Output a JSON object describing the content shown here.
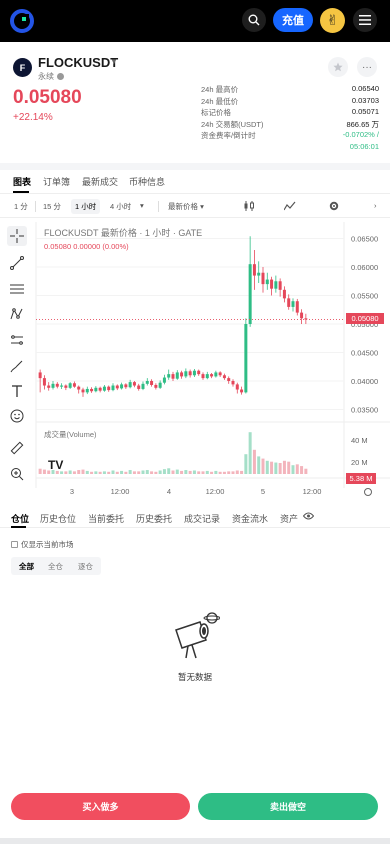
{
  "header": {
    "deposit_label": "充值",
    "avatar_glyph": "✌"
  },
  "pair": {
    "name": "FLOCKUSDT",
    "icon_letter": "F",
    "type_label": "永续",
    "last_price": "0.05080",
    "change_pct": "+22.14%"
  },
  "stats": [
    {
      "label": "24h 最高价",
      "value": "0.06540"
    },
    {
      "label": "24h 最低价",
      "value": "0.03703"
    },
    {
      "label": "标记价格",
      "value": "0.05071"
    },
    {
      "label": "24h 交易额(USDT)",
      "value": "866.65 万"
    },
    {
      "label": "资金费率/倒计时",
      "value": "-0.0702% /"
    },
    {
      "label": "",
      "value": "05:06:01"
    }
  ],
  "tabs": [
    "图表",
    "订单簿",
    "最新成交",
    "币种信息"
  ],
  "toolbar": {
    "intervals": [
      "1 分",
      "15 分",
      "1 小时",
      "4 小时"
    ],
    "active_interval": "1 小时",
    "price_type": "最新价格"
  },
  "chart": {
    "legend_title": "FLOCKUSDT 最新价格 · 1 小时 · GATE",
    "legend_values": "0.05080  0.00000 (0.00%)",
    "volume_label": "成交量(Volume)",
    "price_tag": "0.05080",
    "volume_tag": "5.38 M",
    "tv_logo": "TV"
  },
  "chart_data": {
    "type": "candlestick",
    "title": "FLOCKUSDT 最新价格 · 1 小时 · GATE",
    "price_ticks": [
      "0.06500",
      "0.06000",
      "0.05500",
      "0.05000",
      "0.04500",
      "0.04000",
      "0.03500"
    ],
    "volume_ticks": [
      "40 M",
      "20 M"
    ],
    "x_ticks": [
      "3",
      "12:00",
      "4",
      "12:00",
      "5",
      "12:00"
    ],
    "ylim": [
      0.0335,
      0.0665
    ],
    "volume_max": 50,
    "candles": [
      [
        0.0415,
        0.0405,
        0.042,
        0.038,
        0.12,
        "d"
      ],
      [
        0.0405,
        0.0392,
        0.041,
        0.0385,
        0.1,
        "d"
      ],
      [
        0.0392,
        0.0388,
        0.0398,
        0.0383,
        0.08,
        "d"
      ],
      [
        0.0388,
        0.0395,
        0.04,
        0.0385,
        0.09,
        "u"
      ],
      [
        0.0395,
        0.039,
        0.0398,
        0.0387,
        0.07,
        "d"
      ],
      [
        0.039,
        0.0392,
        0.0396,
        0.0386,
        0.06,
        "u"
      ],
      [
        0.0392,
        0.0388,
        0.0394,
        0.0384,
        0.06,
        "d"
      ],
      [
        0.0388,
        0.0396,
        0.0398,
        0.0386,
        0.08,
        "u"
      ],
      [
        0.0396,
        0.039,
        0.0399,
        0.0388,
        0.06,
        "d"
      ],
      [
        0.039,
        0.0385,
        0.0392,
        0.0378,
        0.09,
        "d"
      ],
      [
        0.0385,
        0.038,
        0.0388,
        0.0372,
        0.1,
        "d"
      ],
      [
        0.038,
        0.0386,
        0.039,
        0.0377,
        0.07,
        "u"
      ],
      [
        0.0386,
        0.0382,
        0.0389,
        0.0379,
        0.05,
        "d"
      ],
      [
        0.0382,
        0.0388,
        0.0391,
        0.038,
        0.06,
        "u"
      ],
      [
        0.0388,
        0.0383,
        0.039,
        0.038,
        0.05,
        "d"
      ],
      [
        0.0383,
        0.039,
        0.0393,
        0.0381,
        0.06,
        "u"
      ],
      [
        0.039,
        0.0384,
        0.0392,
        0.0381,
        0.05,
        "d"
      ],
      [
        0.0384,
        0.0392,
        0.0396,
        0.0382,
        0.08,
        "u"
      ],
      [
        0.0392,
        0.0387,
        0.0394,
        0.0384,
        0.05,
        "d"
      ],
      [
        0.0387,
        0.0394,
        0.0397,
        0.0385,
        0.07,
        "u"
      ],
      [
        0.0394,
        0.0389,
        0.0396,
        0.0386,
        0.05,
        "d"
      ],
      [
        0.0389,
        0.0398,
        0.0402,
        0.0387,
        0.09,
        "u"
      ],
      [
        0.0398,
        0.0392,
        0.04,
        0.0389,
        0.06,
        "d"
      ],
      [
        0.0392,
        0.0386,
        0.0395,
        0.0383,
        0.06,
        "d"
      ],
      [
        0.0386,
        0.0395,
        0.0399,
        0.0384,
        0.08,
        "u"
      ],
      [
        0.0395,
        0.04,
        0.0405,
        0.0392,
        0.09,
        "u"
      ],
      [
        0.04,
        0.0393,
        0.0403,
        0.039,
        0.06,
        "d"
      ],
      [
        0.0393,
        0.0388,
        0.0396,
        0.0385,
        0.05,
        "d"
      ],
      [
        0.0388,
        0.0397,
        0.0401,
        0.0386,
        0.08,
        "u"
      ],
      [
        0.0397,
        0.0406,
        0.0411,
        0.0394,
        0.11,
        "u"
      ],
      [
        0.0406,
        0.0412,
        0.042,
        0.0402,
        0.13,
        "u"
      ],
      [
        0.0412,
        0.0404,
        0.0416,
        0.04,
        0.08,
        "d"
      ],
      [
        0.0404,
        0.0415,
        0.0419,
        0.0402,
        0.1,
        "u"
      ],
      [
        0.0415,
        0.0408,
        0.0418,
        0.0404,
        0.07,
        "d"
      ],
      [
        0.0408,
        0.0417,
        0.0422,
        0.0405,
        0.09,
        "u"
      ],
      [
        0.0417,
        0.041,
        0.042,
        0.0406,
        0.07,
        "d"
      ],
      [
        0.041,
        0.0418,
        0.0421,
        0.0407,
        0.08,
        "u"
      ],
      [
        0.0418,
        0.0412,
        0.042,
        0.0409,
        0.06,
        "d"
      ],
      [
        0.0412,
        0.0405,
        0.0415,
        0.0402,
        0.06,
        "d"
      ],
      [
        0.0405,
        0.0412,
        0.0416,
        0.0403,
        0.07,
        "u"
      ],
      [
        0.0412,
        0.0408,
        0.0414,
        0.0405,
        0.05,
        "d"
      ],
      [
        0.0408,
        0.0415,
        0.0418,
        0.0406,
        0.07,
        "u"
      ],
      [
        0.0415,
        0.041,
        0.0417,
        0.0407,
        0.05,
        "d"
      ],
      [
        0.041,
        0.0405,
        0.0413,
        0.0402,
        0.05,
        "d"
      ],
      [
        0.0405,
        0.04,
        0.0408,
        0.0395,
        0.06,
        "d"
      ],
      [
        0.04,
        0.0394,
        0.0403,
        0.039,
        0.06,
        "d"
      ],
      [
        0.0394,
        0.0385,
        0.0397,
        0.0378,
        0.08,
        "d"
      ],
      [
        0.0385,
        0.038,
        0.039,
        0.0376,
        0.07,
        "d"
      ],
      [
        0.038,
        0.05,
        0.051,
        0.0378,
        0.45,
        "u"
      ],
      [
        0.05,
        0.0605,
        0.0654,
        0.0495,
        0.95,
        "u"
      ],
      [
        0.0605,
        0.0585,
        0.063,
        0.056,
        0.55,
        "d"
      ],
      [
        0.0585,
        0.059,
        0.061,
        0.0572,
        0.4,
        "u"
      ],
      [
        0.059,
        0.057,
        0.06,
        0.0555,
        0.35,
        "d"
      ],
      [
        0.057,
        0.0578,
        0.059,
        0.056,
        0.3,
        "u"
      ],
      [
        0.0578,
        0.0562,
        0.0583,
        0.055,
        0.28,
        "d"
      ],
      [
        0.0562,
        0.0575,
        0.0585,
        0.0555,
        0.26,
        "u"
      ],
      [
        0.0575,
        0.056,
        0.058,
        0.0548,
        0.25,
        "d"
      ],
      [
        0.056,
        0.0545,
        0.0566,
        0.0538,
        0.3,
        "d"
      ],
      [
        0.0545,
        0.053,
        0.0552,
        0.0525,
        0.28,
        "d"
      ],
      [
        0.053,
        0.054,
        0.0545,
        0.0522,
        0.2,
        "u"
      ],
      [
        0.054,
        0.052,
        0.0544,
        0.0515,
        0.22,
        "d"
      ],
      [
        0.052,
        0.051,
        0.0526,
        0.05,
        0.18,
        "d"
      ],
      [
        0.051,
        0.0508,
        0.0518,
        0.05,
        0.12,
        "d"
      ]
    ]
  },
  "position_tabs": [
    "仓位",
    "历史仓位",
    "当前委托",
    "历史委托",
    "成交记录",
    "资金流水",
    "资产"
  ],
  "only_current_label": "仅显示当前市场",
  "filters": [
    "全部",
    "全仓",
    "逐仓"
  ],
  "empty_text": "暂无数据",
  "actions": {
    "buy_label": "买入做多",
    "sell_label": "卖出做空"
  },
  "colors": {
    "up": "#2ebd85",
    "down": "#e5475a",
    "accent": "#1666ff"
  }
}
